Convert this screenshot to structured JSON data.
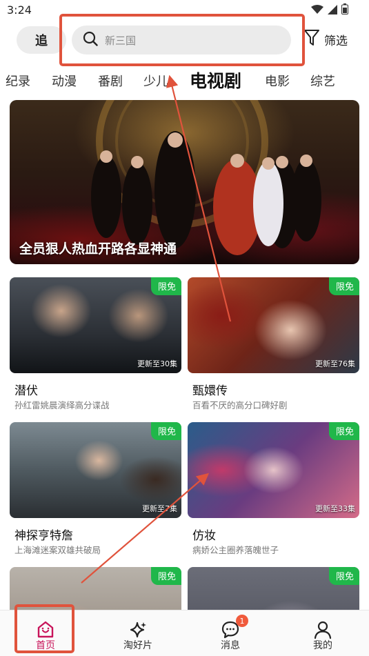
{
  "status_bar": {
    "time": "3:24"
  },
  "header": {
    "follow_label": "追",
    "search_placeholder": "新三国",
    "filter_label": "筛选"
  },
  "tabs": [
    "纪录",
    "动漫",
    "番剧",
    "少儿",
    "电视剧",
    "电影",
    "综艺"
  ],
  "active_tab": "电视剧",
  "hero": {
    "caption": "全员狠人热血开路各显神通"
  },
  "cards": [
    {
      "title": "潜伏",
      "desc": "孙红雷姚晨演绎高分谍战",
      "badge": "限免",
      "update": "更新至30集"
    },
    {
      "title": "甄嬛传",
      "desc": "百看不厌的高分口碑好剧",
      "badge": "限免",
      "update": "更新至76集"
    },
    {
      "title": "神探亨特詹",
      "desc": "上海滩迷案双雄共破局",
      "badge": "限免",
      "update": "更新至7集"
    },
    {
      "title": "仿妆",
      "desc": "病娇公主圈养落魄世子",
      "badge": "限免",
      "update": "更新至33集"
    },
    {
      "title": "",
      "desc": "",
      "badge": "限免",
      "update": ""
    },
    {
      "title": "",
      "desc": "",
      "badge": "限免",
      "update": ""
    }
  ],
  "bottom_nav": [
    {
      "label": "首页",
      "icon": "home-icon"
    },
    {
      "label": "淘好片",
      "icon": "sparkle-icon"
    },
    {
      "label": "消息",
      "icon": "message-icon",
      "badge": "1"
    },
    {
      "label": "我的",
      "icon": "profile-icon"
    }
  ],
  "colors": {
    "accent": "#c8145a",
    "free_badge": "#20b74a",
    "annotation": "#e0533c"
  }
}
